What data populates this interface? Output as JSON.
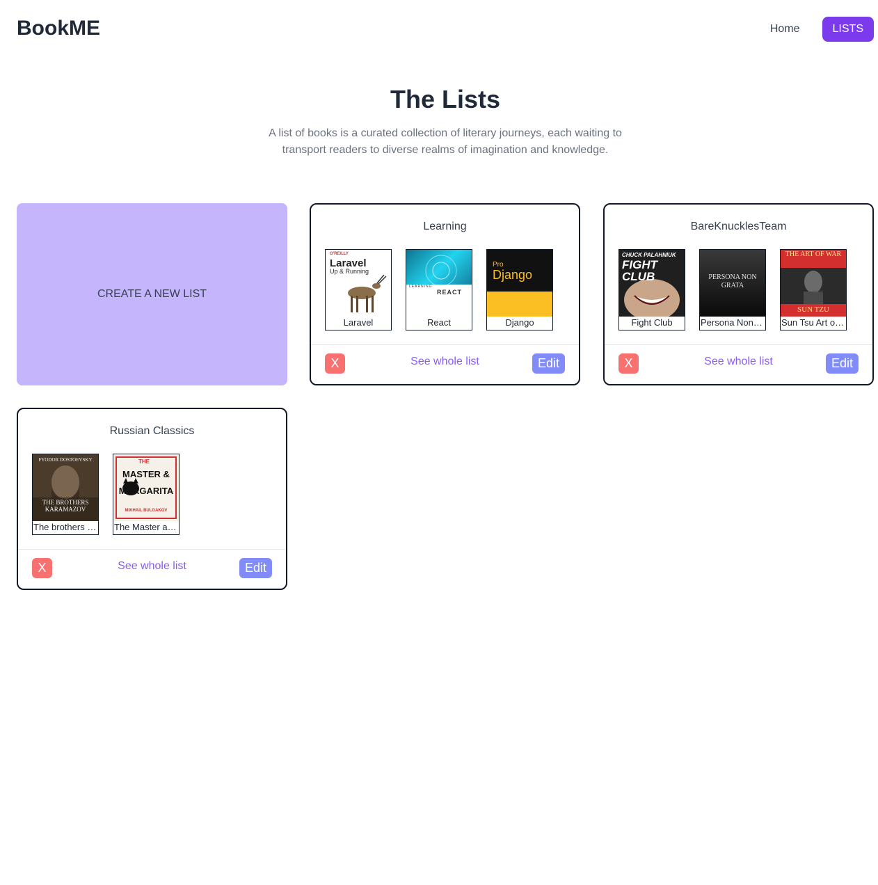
{
  "brand": "BookME",
  "nav": {
    "home": "Home",
    "lists": "LISTS"
  },
  "hero": {
    "title": "The Lists",
    "subtitle": "A list of books is a curated collection of literary journeys, each waiting to transport readers to diverse realms of imagination and knowledge."
  },
  "create": {
    "label": "CREATE A NEW LIST"
  },
  "lists": [
    {
      "title": "Learning",
      "books": [
        {
          "label": "Laravel",
          "cover": {
            "publisher": "O'REILLY",
            "title": "Laravel",
            "subtitle": "Up & Running"
          }
        },
        {
          "label": "React",
          "cover": {
            "title": "REACT",
            "top": "LEARNING"
          }
        },
        {
          "label": "Django",
          "cover": {
            "top": "Pro",
            "title": "Django"
          }
        }
      ],
      "delete": "X",
      "see": "See whole list",
      "edit": "Edit"
    },
    {
      "title": "BareKnucklesTeam",
      "books": [
        {
          "label": "Fight Club",
          "cover": {
            "author": "CHUCK PALAHNIUK",
            "title": "FIGHT CLUB"
          }
        },
        {
          "label": "Persona Non Grata",
          "cover": {
            "title": "PERSONA NON GRATA"
          }
        },
        {
          "label": "Sun Tsu Art of War",
          "cover": {
            "title": "THE ART OF WAR",
            "author": "SUN TZU"
          }
        }
      ],
      "delete": "X",
      "see": "See whole list",
      "edit": "Edit"
    },
    {
      "title": "Russian Classics",
      "books": [
        {
          "label": "The brothers Karamazov",
          "cover": {
            "author": "FYODOR DOSTOEVSKY",
            "title": "THE BROTHERS KARAMAZOV"
          }
        },
        {
          "label": "The Master and Margarita",
          "cover": {
            "top": "THE",
            "title": "MASTER & MARGARITA",
            "author": "MIKHAIL BULGAKOV"
          }
        }
      ],
      "delete": "X",
      "see": "See whole list",
      "edit": "Edit"
    }
  ],
  "colors": {
    "accent": "#7c3aed",
    "create_card": "#c4b5fd",
    "delete_button": "#f87171",
    "edit_button": "#818cf8",
    "link": "#8b5cf6"
  }
}
